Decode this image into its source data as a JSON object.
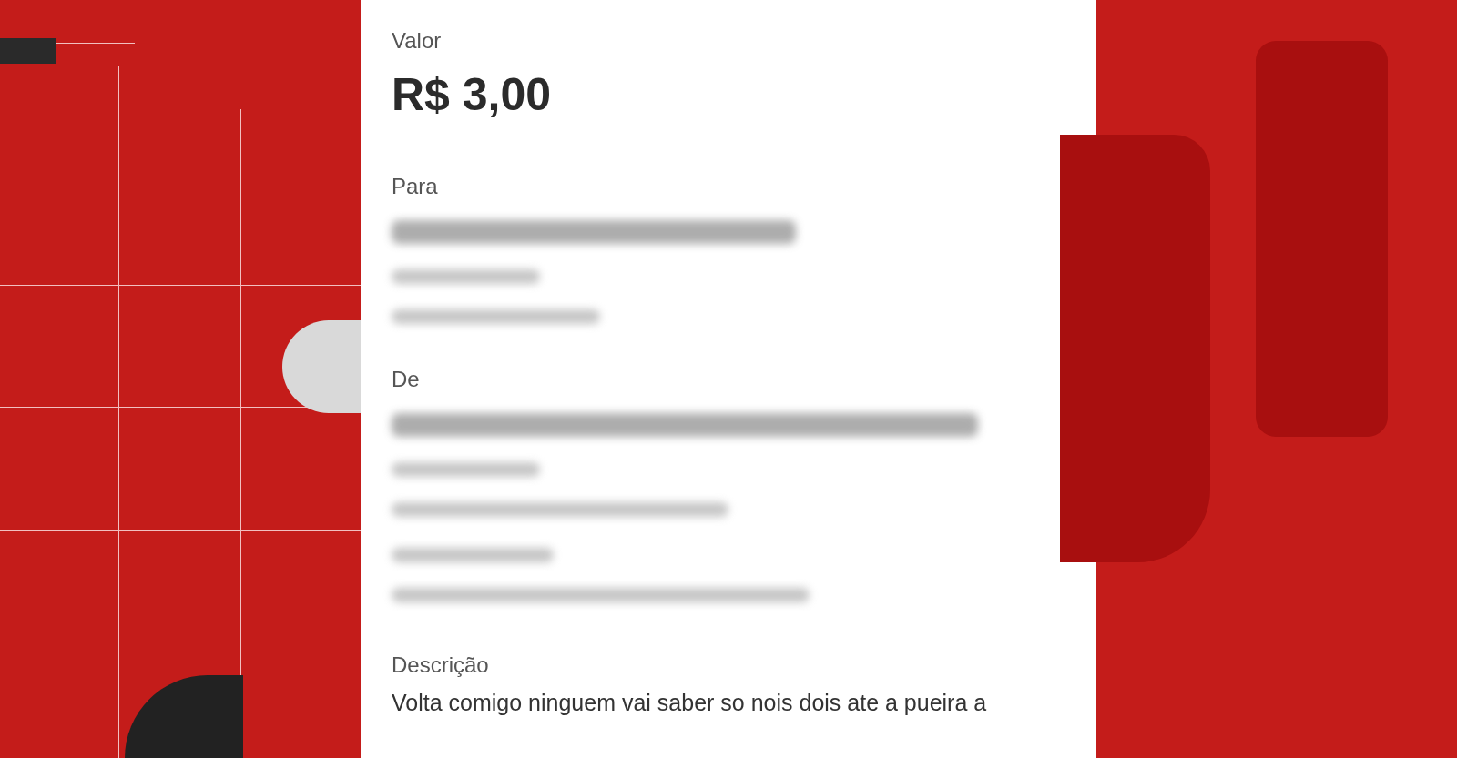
{
  "receipt": {
    "amount_label": "Valor",
    "amount": "R$ 3,00",
    "sections": [
      {
        "kind": "party",
        "label": "Para"
      },
      {
        "kind": "party",
        "label": "De"
      },
      {
        "kind": "redacted"
      }
    ],
    "description_label": "Descrição",
    "description": "Volta comigo ninguem vai saber so nois dois ate a pueira a"
  }
}
